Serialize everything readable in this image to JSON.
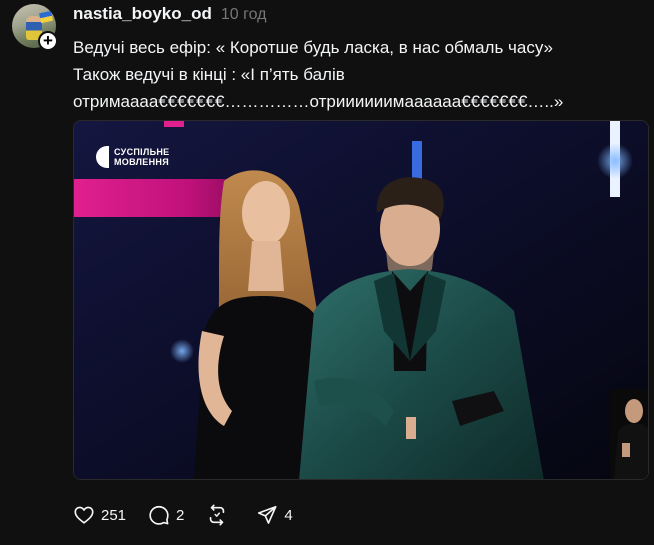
{
  "post": {
    "username": "nastia_boyko_od",
    "timestamp": "10 год",
    "follow_symbol": "+",
    "text_lines": [
      "Ведучі весь ефір: « Коротше будь ласка, в нас обмаль часу»",
      "Також ведучі в кінці : «І п’ять балів",
      "отримаааа€€€€€€€……………отриииииимаааааа€€€€€€€…..»"
    ]
  },
  "media": {
    "broadcaster_line1": "СУСПІЛЬНЕ",
    "broadcaster_line2": "МОВЛЕННЯ"
  },
  "actions": {
    "likes": "251",
    "replies": "2",
    "repost_label": "",
    "shares": "4"
  },
  "icons": {
    "like": "heart-icon",
    "reply": "comment-icon",
    "repost": "repost-icon",
    "share": "send-icon"
  }
}
